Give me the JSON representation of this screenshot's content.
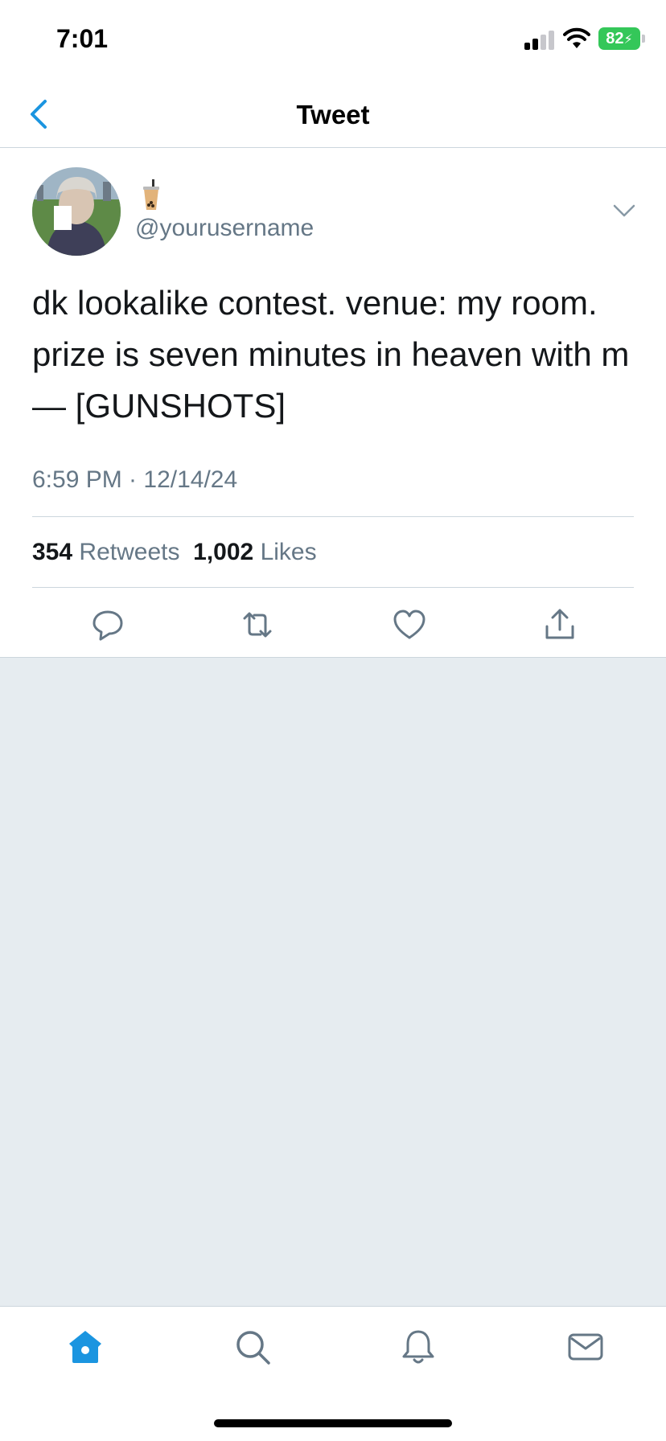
{
  "status_bar": {
    "time": "7:01",
    "battery": "82"
  },
  "nav": {
    "title": "Tweet"
  },
  "tweet": {
    "handle": "@yourusername",
    "text": "dk lookalike contest. venue: my room. prize is seven minutes in heaven with m— [GUNSHOTS]",
    "timestamp": "6:59 PM · 12/14/24",
    "retweets_count": "354",
    "retweets_label": "Retweets",
    "likes_count": "1,002",
    "likes_label": "Likes"
  },
  "icons": {
    "back": "chevron-left-icon",
    "caret": "chevron-down-icon",
    "reply": "reply-icon",
    "retweet": "retweet-icon",
    "like": "heart-icon",
    "share": "share-icon",
    "home": "home-icon",
    "search": "search-icon",
    "notifications": "bell-icon",
    "messages": "mail-icon"
  },
  "colors": {
    "accent": "#1b95e0",
    "secondary_text": "#657786",
    "empty_background": "#e6ecf0",
    "battery": "#34c759"
  }
}
